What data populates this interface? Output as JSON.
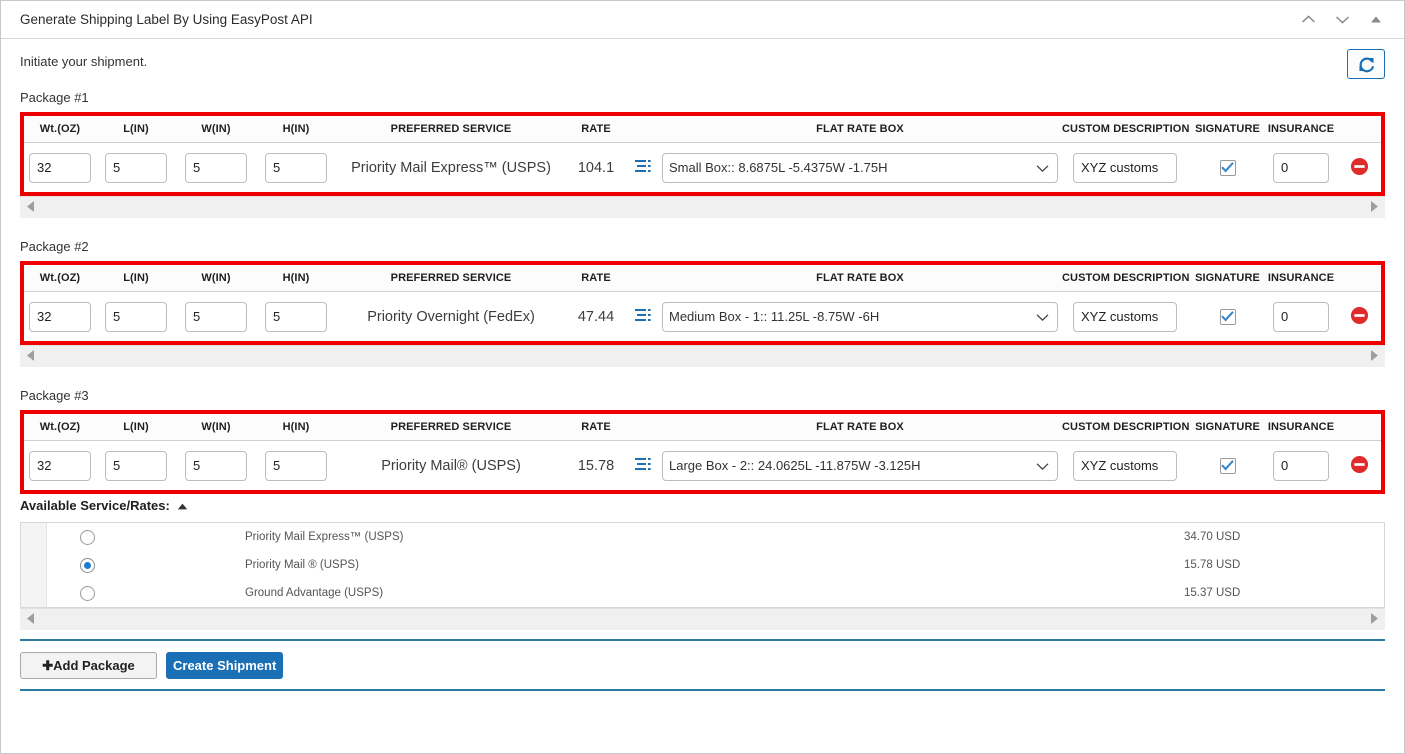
{
  "window": {
    "title": "Generate Shipping Label By Using EasyPost API",
    "actions": [
      {
        "name": "collapse-up-icon",
        "glyph": "chevron-up"
      },
      {
        "name": "expand-down-icon",
        "glyph": "chevron-down"
      },
      {
        "name": "minimize-icon",
        "glyph": "triangle-up"
      }
    ]
  },
  "subtitle": "Initiate your shipment.",
  "refresh": {
    "label": "refresh-icon",
    "color": "#1a6fb5"
  },
  "columns": {
    "weight": "Wt.(OZ)",
    "length": "L(IN)",
    "width": "W(IN)",
    "height": "H(IN)",
    "preferred_service": "PREFERRED SERVICE",
    "rate": "RATE",
    "flat_rate_box": "FLAT RATE BOX",
    "custom_description": "CUSTOM DESCRIPTION",
    "signature": "SIGNATURE",
    "insurance": "INSURANCE"
  },
  "packages": [
    {
      "label": "Package #1",
      "weight": "32",
      "length": "5",
      "width": "5",
      "height": "5",
      "preferred_service": "Priority Mail Express™ (USPS)",
      "rate": "104.1",
      "flat_rate_box": "Small Box:: 8.6875L -5.4375W -1.75H",
      "custom_description": "XYZ customs",
      "signature_checked": true,
      "insurance": "0"
    },
    {
      "label": "Package #2",
      "weight": "32",
      "length": "5",
      "width": "5",
      "height": "5",
      "preferred_service": "Priority Overnight (FedEx)",
      "rate": "47.44",
      "flat_rate_box": "Medium Box - 1:: 11.25L -8.75W -6H",
      "custom_description": "XYZ customs",
      "signature_checked": true,
      "insurance": "0"
    },
    {
      "label": "Package #3",
      "weight": "32",
      "length": "5",
      "width": "5",
      "height": "5",
      "preferred_service": "Priority Mail® (USPS)",
      "rate": "15.78",
      "flat_rate_box": "Large Box - 2:: 24.0625L -11.875W -3.125H",
      "custom_description": "XYZ customs",
      "signature_checked": true,
      "insurance": "0"
    }
  ],
  "available_rates": {
    "title": "Available Service/Rates:",
    "caret": "collapse-caret-up-icon",
    "rows": [
      {
        "service": "Priority Mail Express™ (USPS)",
        "price": "34.70 USD",
        "selected": false
      },
      {
        "service": "Priority Mail ® (USPS)",
        "price": "15.78 USD",
        "selected": true
      },
      {
        "service": "Ground Advantage (USPS)",
        "price": "15.37 USD",
        "selected": false
      }
    ]
  },
  "footer": {
    "add_package": "✚Add Package",
    "create_shipment": "Create Shipment"
  },
  "colors": {
    "highlight_red": "#ee0000",
    "accent_blue": "#1a6fb5",
    "rule_teal": "#2b7ca3",
    "delete_red": "#e02b2b"
  }
}
